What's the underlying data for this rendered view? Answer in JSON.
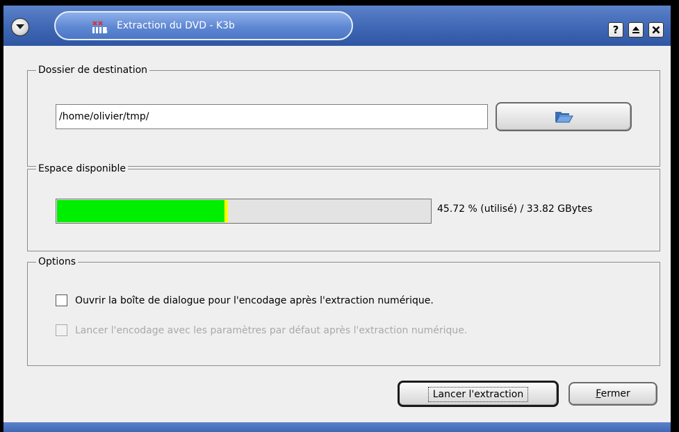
{
  "window": {
    "title": "Extraction du DVD - K3b",
    "app_icon": "k3b-icon",
    "title_buttons": [
      {
        "name": "help-button",
        "label": "?"
      },
      {
        "name": "eject-button",
        "label": "⏏"
      },
      {
        "name": "close-button",
        "label": "✕"
      }
    ]
  },
  "destination": {
    "legend": "Dossier de destination",
    "path_value": "/home/olivier/tmp/",
    "browse_icon": "folder-open-icon"
  },
  "space": {
    "legend": "Espace disponible",
    "used_fraction": 0.4572,
    "text": "45.72 % (utilisé) / 33.82 GBytes"
  },
  "options": {
    "legend": "Options",
    "items": [
      {
        "label": "Ouvrir la boîte de dialogue pour l'encodage après l'extraction numérique.",
        "checked": false,
        "enabled": true
      },
      {
        "label": "Lancer l'encodage avec les paramètres par défaut après l'extraction numérique.",
        "checked": false,
        "enabled": false
      }
    ]
  },
  "buttons": {
    "start": "Lancer l'extraction",
    "close": "Fermer"
  },
  "colors": {
    "titlebar": "#3f67b4",
    "progress_used": "#00ee00",
    "progress_marker": "#ffff00"
  }
}
